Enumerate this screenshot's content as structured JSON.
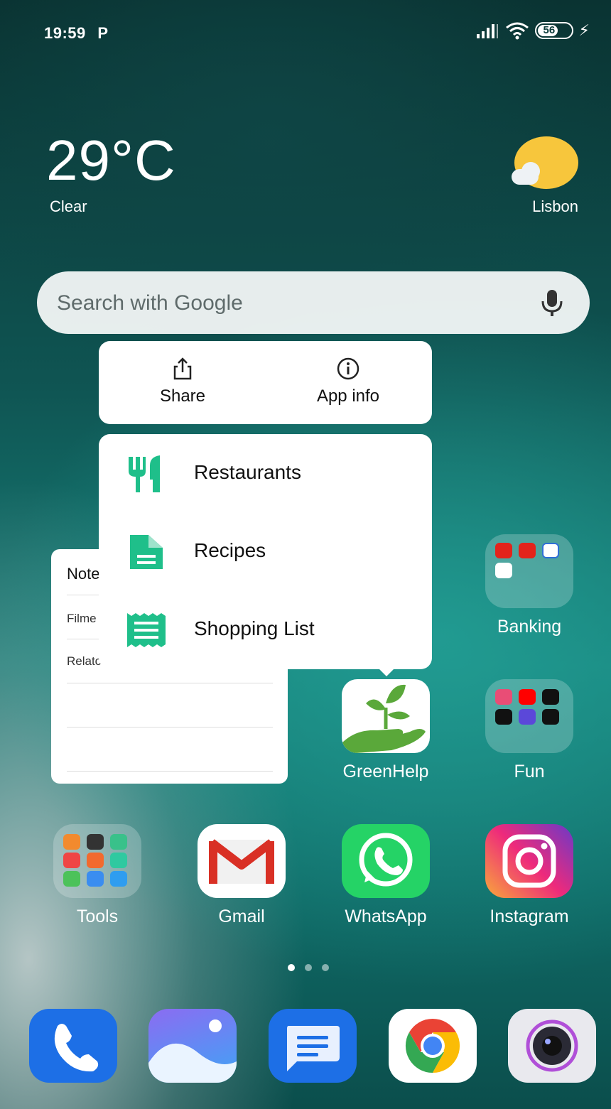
{
  "status_bar": {
    "time": "19:59",
    "carrier_icon": "p-icon",
    "battery": "56"
  },
  "weather": {
    "temperature": "29°C",
    "condition": "Clear",
    "city": "Lisbon"
  },
  "search": {
    "placeholder": "Search with Google"
  },
  "popup_actions": [
    {
      "label": "Share"
    },
    {
      "label": "App info"
    }
  ],
  "shortcuts": [
    {
      "label": "Restaurants",
      "icon": "fork-knife-icon"
    },
    {
      "label": "Recipes",
      "icon": "document-icon"
    },
    {
      "label": "Shopping List",
      "icon": "receipt-icon"
    }
  ],
  "notes_widget": {
    "title": "Note",
    "rows": [
      "Filme",
      "Relato"
    ]
  },
  "apps": {
    "banking": "Banking",
    "greenhelp": "GreenHelp",
    "fun": "Fun",
    "tools": "Tools",
    "gmail": "Gmail",
    "whatsapp": "WhatsApp",
    "instagram": "Instagram"
  },
  "dock": [
    "phone-icon",
    "gallery-icon",
    "messages-icon",
    "chrome-icon",
    "camera-icon"
  ],
  "colors": {
    "accent_green": "#1fbf8a",
    "menu_bg": "#ffffff"
  }
}
